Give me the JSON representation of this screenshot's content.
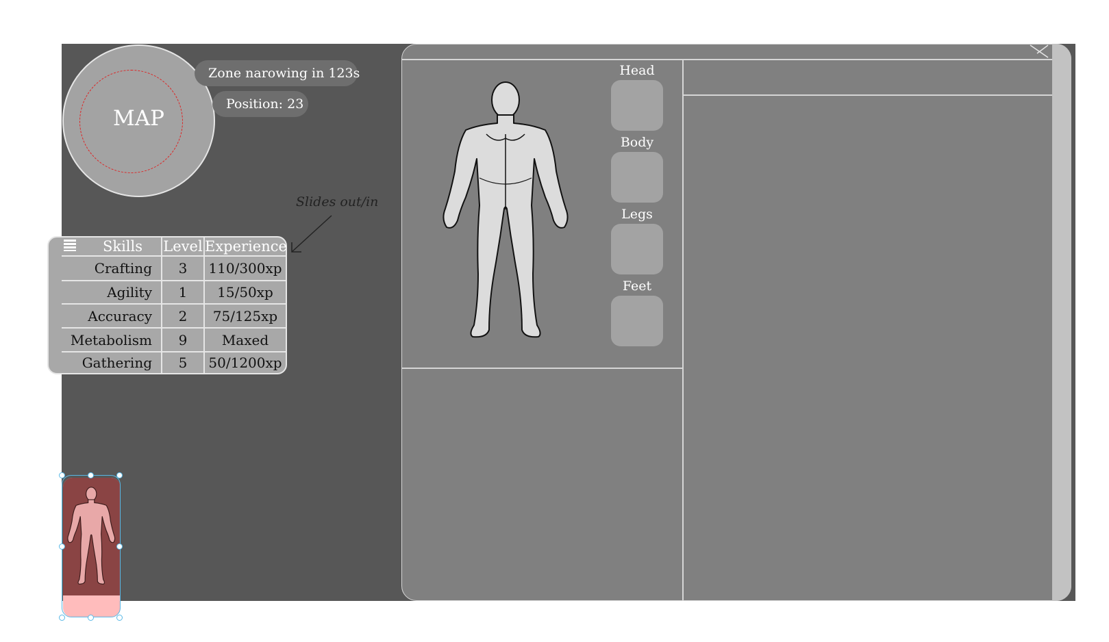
{
  "map": {
    "label": "MAP"
  },
  "hud": {
    "zone": "Zone narowing in 123s",
    "position": "Position: 23"
  },
  "note": {
    "slides": "Slides out/in"
  },
  "skills": {
    "headers": {
      "skill": "Skills",
      "level": "Level",
      "experience": "Experience"
    },
    "rows": [
      {
        "skill": "Crafting",
        "level": "3",
        "experience": "110/300xp"
      },
      {
        "skill": "Agility",
        "level": "1",
        "experience": "15/50xp"
      },
      {
        "skill": "Accuracy",
        "level": "2",
        "experience": "75/125xp"
      },
      {
        "skill": "Metabolism",
        "level": "9",
        "experience": "Maxed"
      },
      {
        "skill": "Gathering",
        "level": "5",
        "experience": "50/1200xp"
      }
    ]
  },
  "equipment": {
    "slots": [
      {
        "label": "Head"
      },
      {
        "label": "Body"
      },
      {
        "label": "Legs"
      },
      {
        "label": "Feet"
      }
    ]
  },
  "icons": [
    "menu-icon",
    "close-icon",
    "body-figure",
    "arrow-icon"
  ],
  "colors": {
    "background": "#575757",
    "panel": "#808080",
    "slot": "#a3a3a3",
    "map_ring": "#e02020",
    "selection": "#59b8e6",
    "thumb": "#8a4444"
  }
}
